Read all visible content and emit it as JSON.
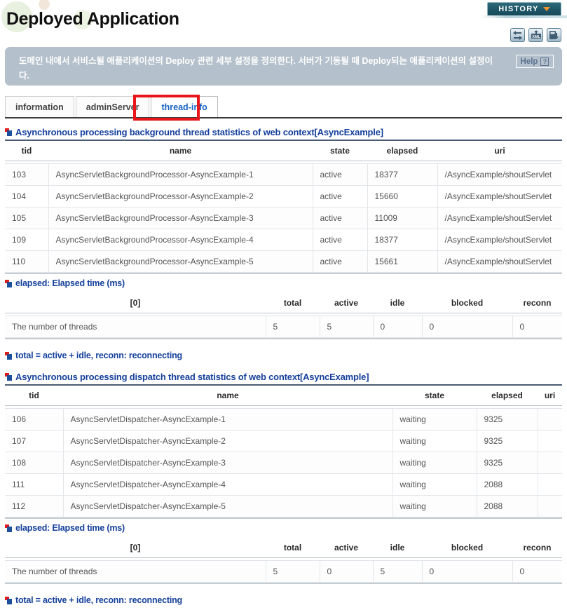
{
  "header": {
    "title": "Deployed Application",
    "history_label": "HISTORY",
    "history_icon": "chevron-down-icon",
    "toolbar": [
      {
        "name": "refresh-icon",
        "title": "refresh"
      },
      {
        "name": "xml-export-icon",
        "title": "XML"
      },
      {
        "name": "save-export-icon",
        "title": "save"
      }
    ]
  },
  "description": {
    "text": "도메인 내에서 서비스될 애플리케이션의 Deploy 관련 세부 설정을 정의한다. 서버가 기동될 때 Deploy되는 애플리케이션의 설정이다.",
    "help_label": "Help",
    "help_icon": "question-mark-icon"
  },
  "tabs": [
    {
      "label": "information",
      "active": false
    },
    {
      "label": "adminServer",
      "active": false
    },
    {
      "label": "thread-info",
      "active": true
    }
  ],
  "sections": {
    "background": {
      "heading": "Asynchronous processing background thread statistics of web context[AsyncExample]",
      "columns": [
        "tid",
        "name",
        "state",
        "elapsed",
        "uri"
      ],
      "rows": [
        {
          "tid": "103",
          "name": "AsyncServletBackgroundProcessor-AsyncExample-1",
          "state": "active",
          "elapsed": "18377",
          "uri": "/AsyncExample/shoutServlet"
        },
        {
          "tid": "104",
          "name": "AsyncServletBackgroundProcessor-AsyncExample-2",
          "state": "active",
          "elapsed": "15660",
          "uri": "/AsyncExample/shoutServlet"
        },
        {
          "tid": "105",
          "name": "AsyncServletBackgroundProcessor-AsyncExample-3",
          "state": "active",
          "elapsed": "11009",
          "uri": "/AsyncExample/shoutServlet"
        },
        {
          "tid": "109",
          "name": "AsyncServletBackgroundProcessor-AsyncExample-4",
          "state": "active",
          "elapsed": "18377",
          "uri": "/AsyncExample/shoutServlet"
        },
        {
          "tid": "110",
          "name": "AsyncServletBackgroundProcessor-AsyncExample-5",
          "state": "active",
          "elapsed": "15661",
          "uri": "/AsyncExample/shoutServlet"
        }
      ],
      "elapsed_note": "elapsed: Elapsed time (ms)",
      "summary": {
        "columns": [
          "[0]",
          "total",
          "active",
          "idle",
          "blocked",
          "reconn"
        ],
        "row": {
          "label": "The number of threads",
          "total": "5",
          "active": "5",
          "idle": "0",
          "blocked": "0",
          "reconn": "0"
        }
      },
      "legend": "total = active + idle, reconn: reconnecting"
    },
    "dispatch": {
      "heading": "Asynchronous processing dispatch thread statistics of web context[AsyncExample]",
      "columns": [
        "tid",
        "name",
        "state",
        "elapsed",
        "uri"
      ],
      "rows": [
        {
          "tid": "106",
          "name": "AsyncServletDispatcher-AsyncExample-1",
          "state": "waiting",
          "elapsed": "9325",
          "uri": ""
        },
        {
          "tid": "107",
          "name": "AsyncServletDispatcher-AsyncExample-2",
          "state": "waiting",
          "elapsed": "9325",
          "uri": ""
        },
        {
          "tid": "108",
          "name": "AsyncServletDispatcher-AsyncExample-3",
          "state": "waiting",
          "elapsed": "9325",
          "uri": ""
        },
        {
          "tid": "111",
          "name": "AsyncServletDispatcher-AsyncExample-4",
          "state": "waiting",
          "elapsed": "2088",
          "uri": ""
        },
        {
          "tid": "112",
          "name": "AsyncServletDispatcher-AsyncExample-5",
          "state": "waiting",
          "elapsed": "2088",
          "uri": ""
        }
      ],
      "elapsed_note": "elapsed: Elapsed time (ms)",
      "summary": {
        "columns": [
          "[0]",
          "total",
          "active",
          "idle",
          "blocked",
          "reconn"
        ],
        "row": {
          "label": "The number of threads",
          "total": "5",
          "active": "0",
          "idle": "5",
          "blocked": "0",
          "reconn": "0"
        }
      },
      "legend": "total = active + idle, reconn: reconnecting"
    }
  },
  "colors": {
    "heading_blue": "#15409c",
    "tab_active_blue": "#1763c6",
    "highlight_red": "#e8161a",
    "desc_bar": "#b4c0cb",
    "history_teal": "#1d5566",
    "history_chevron": "#f0922b"
  }
}
